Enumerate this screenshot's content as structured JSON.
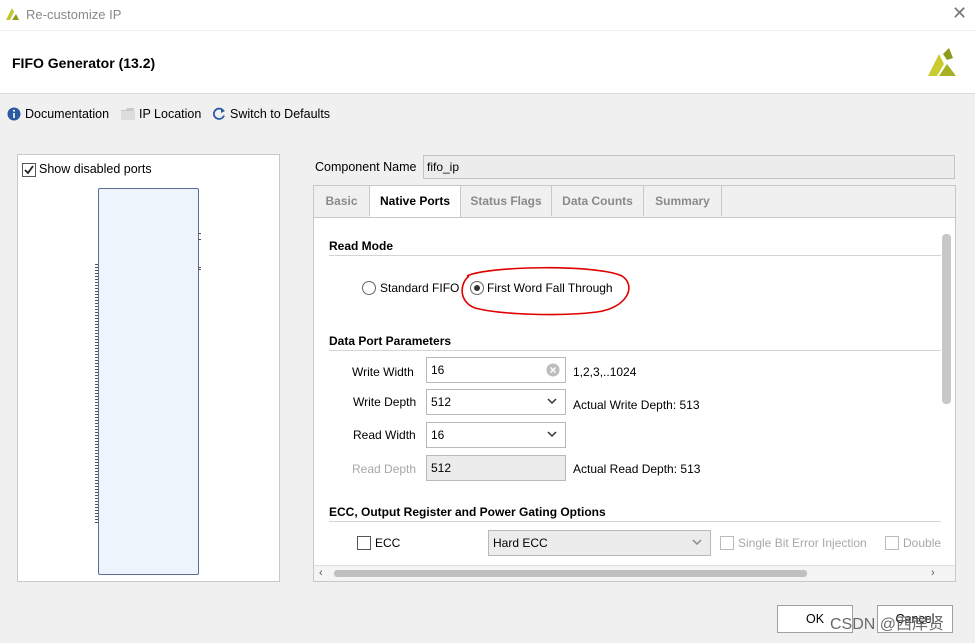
{
  "window": {
    "title": "Re-customize IP",
    "close_glyph": "✕"
  },
  "header": {
    "ip_title": "FIFO Generator (13.2)"
  },
  "toolbar": {
    "documentation": "Documentation",
    "ip_location": "IP Location",
    "switch_defaults": "Switch to Defaults"
  },
  "left_panel": {
    "show_disabled_ports": "Show disabled ports",
    "show_disabled_checked": true
  },
  "component": {
    "label": "Component Name",
    "value": "fifo_ip"
  },
  "tabs": [
    {
      "label": "Basic",
      "active": false
    },
    {
      "label": "Native Ports",
      "active": true
    },
    {
      "label": "Status Flags",
      "active": false
    },
    {
      "label": "Data Counts",
      "active": false
    },
    {
      "label": "Summary",
      "active": false
    }
  ],
  "read_mode": {
    "heading": "Read Mode",
    "standard": "Standard FIFO",
    "fwft": "First Word Fall Through",
    "selected": "fwft"
  },
  "data_port": {
    "heading": "Data Port Parameters",
    "write_width_label": "Write Width",
    "write_width_value": "16",
    "write_width_range": "1,2,3,..1024",
    "write_depth_label": "Write Depth",
    "write_depth_value": "512",
    "actual_write_depth": "Actual Write Depth: 513",
    "read_width_label": "Read Width",
    "read_width_value": "16",
    "read_depth_label": "Read Depth",
    "read_depth_value": "512",
    "actual_read_depth": "Actual Read Depth: 513"
  },
  "ecc": {
    "heading": "ECC, Output Register and Power Gating Options",
    "ecc_label": "ECC",
    "ecc_type": "Hard ECC",
    "single_bit": "Single Bit Error Injection",
    "double_bit": "Double"
  },
  "buttons": {
    "ok": "OK",
    "cancel": "Cancel"
  },
  "watermark": "CSDN @西岸贤",
  "colors": {
    "annotation": "#e00000",
    "brand": "#b5be2a",
    "symbol_border": "#5a6e99"
  }
}
